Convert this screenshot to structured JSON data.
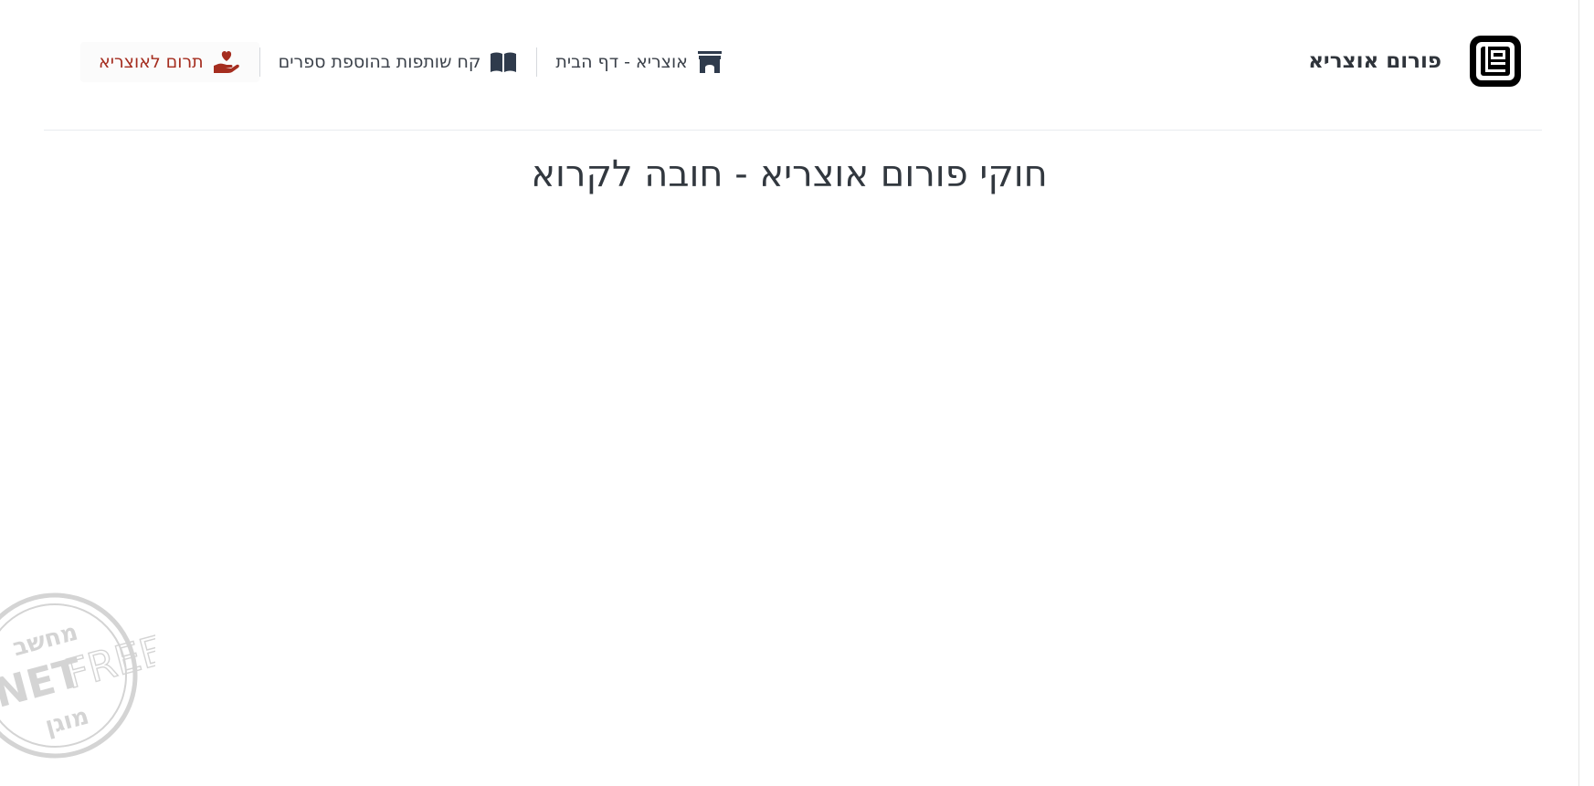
{
  "header": {
    "brand_name": "פורום אוצריא",
    "nav": [
      {
        "label": "תרום לאוצריא",
        "icon": "hand-heart-icon",
        "color": "#a52d1f"
      },
      {
        "label": "קח שותפות בהוספת ספרים",
        "icon": "open-book-icon",
        "color": "#2f3b4c"
      },
      {
        "label": "אוצריא - דף הבית",
        "icon": "archway-icon",
        "color": "#2f3b4c"
      }
    ]
  },
  "main": {
    "title": "חוקי פורום אוצריא - חובה לקרוא"
  },
  "watermark": {
    "top_text": "מחשב",
    "middle_text_1": "NET",
    "middle_text_2": "FREE",
    "bottom_text": "מוגן"
  }
}
